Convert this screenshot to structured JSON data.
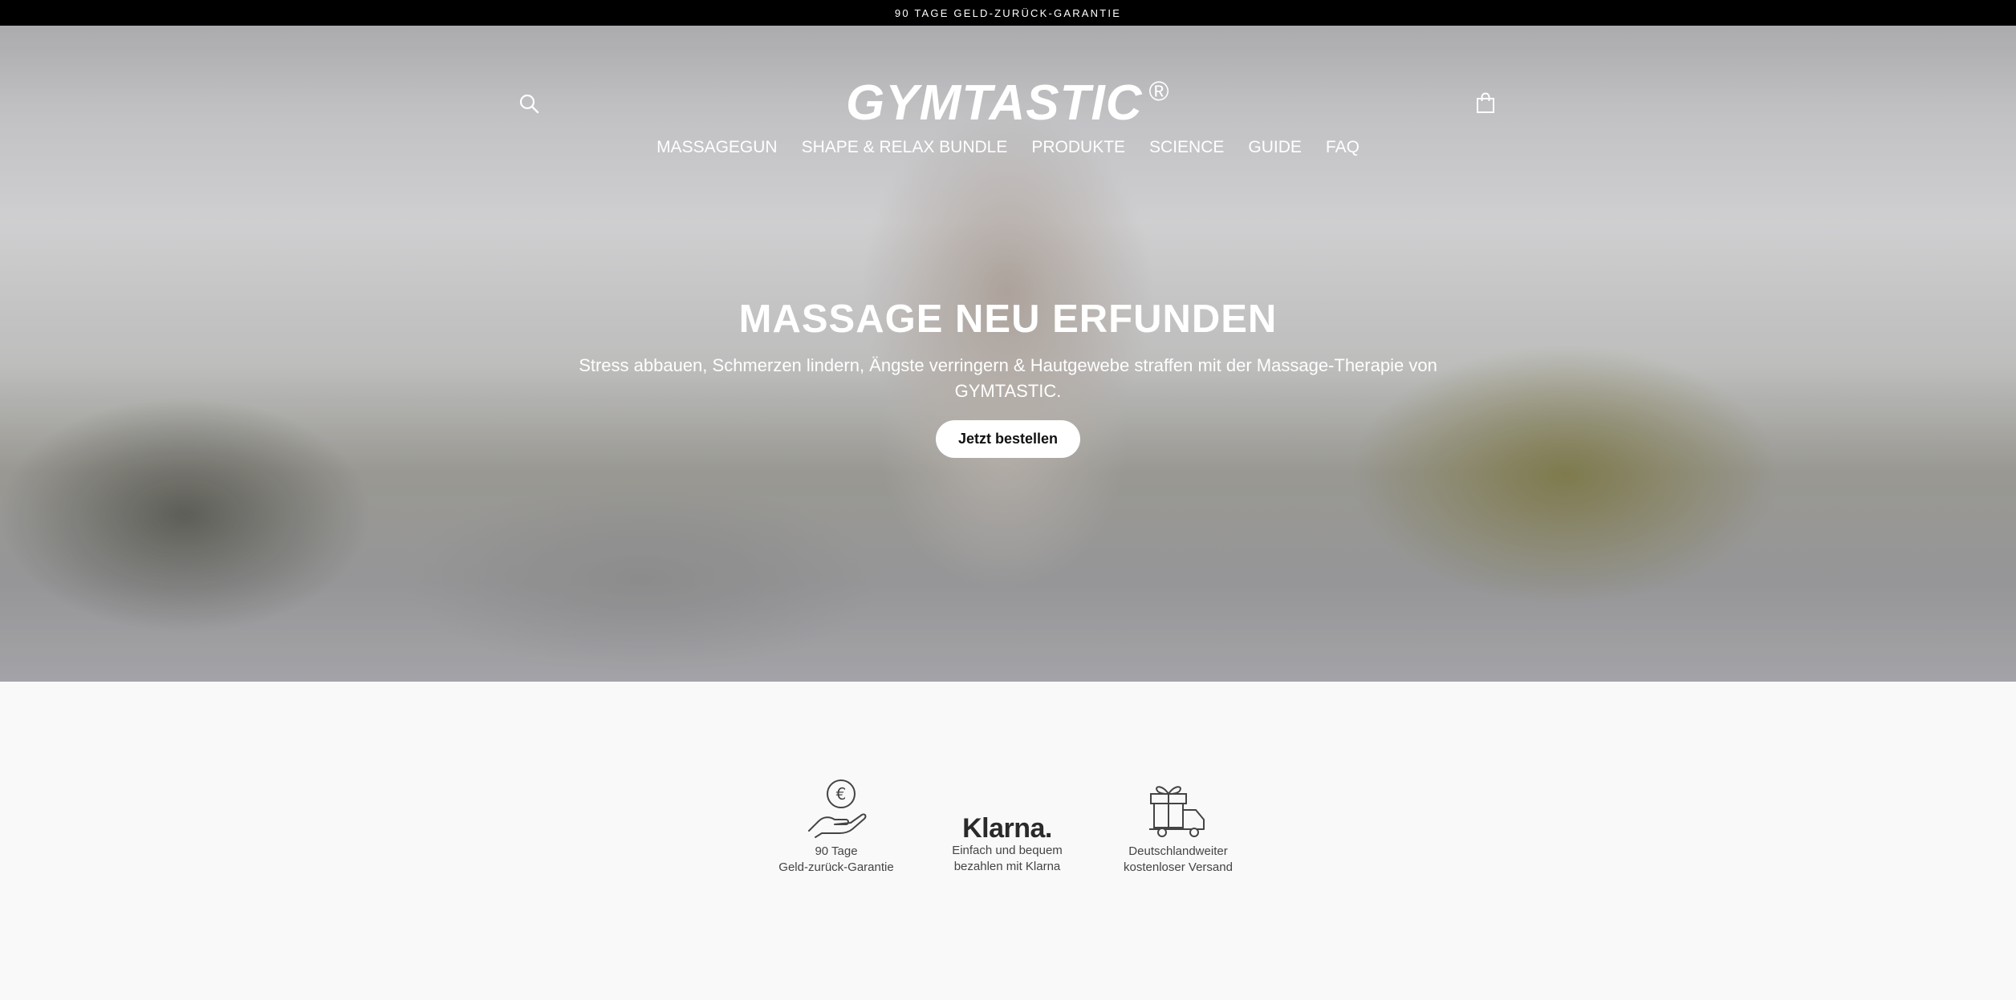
{
  "announcement": {
    "text": "90 TAGE GELD-ZURÜCK-GARANTIE"
  },
  "header": {
    "logo_text": "GYMTASTIC",
    "logo_mark": "®",
    "search_icon": "search-icon",
    "cart_icon": "cart-icon"
  },
  "nav": {
    "items": [
      {
        "label": "MASSAGEGUN"
      },
      {
        "label": "SHAPE & RELAX BUNDLE"
      },
      {
        "label": "PRODUKTE"
      },
      {
        "label": "SCIENCE"
      },
      {
        "label": "GUIDE"
      },
      {
        "label": "FAQ"
      }
    ]
  },
  "hero": {
    "title": "MASSAGE NEU ERFUNDEN",
    "subtitle": "Stress abbauen, Schmerzen lindern, Ängste verringern & Hautgewebe straffen mit der Massage-Therapie von GYMTASTIC.",
    "cta_label": "Jetzt bestellen"
  },
  "features": [
    {
      "icon": "hand-euro-icon",
      "line1": "90 Tage",
      "line2": "Geld-zurück-Garantie"
    },
    {
      "icon": "klarna-logo",
      "logo_text": "Klarna.",
      "line1": "Einfach und bequem",
      "line2": "bezahlen mit Klarna"
    },
    {
      "icon": "gift-truck-icon",
      "line1": "Deutschlandweiter",
      "line2": "kostenloser Versand"
    }
  ],
  "colors": {
    "announcement_bg": "#000000",
    "text_light": "#ffffff",
    "page_bg": "#f9f9f9",
    "feature_text": "#444444"
  }
}
